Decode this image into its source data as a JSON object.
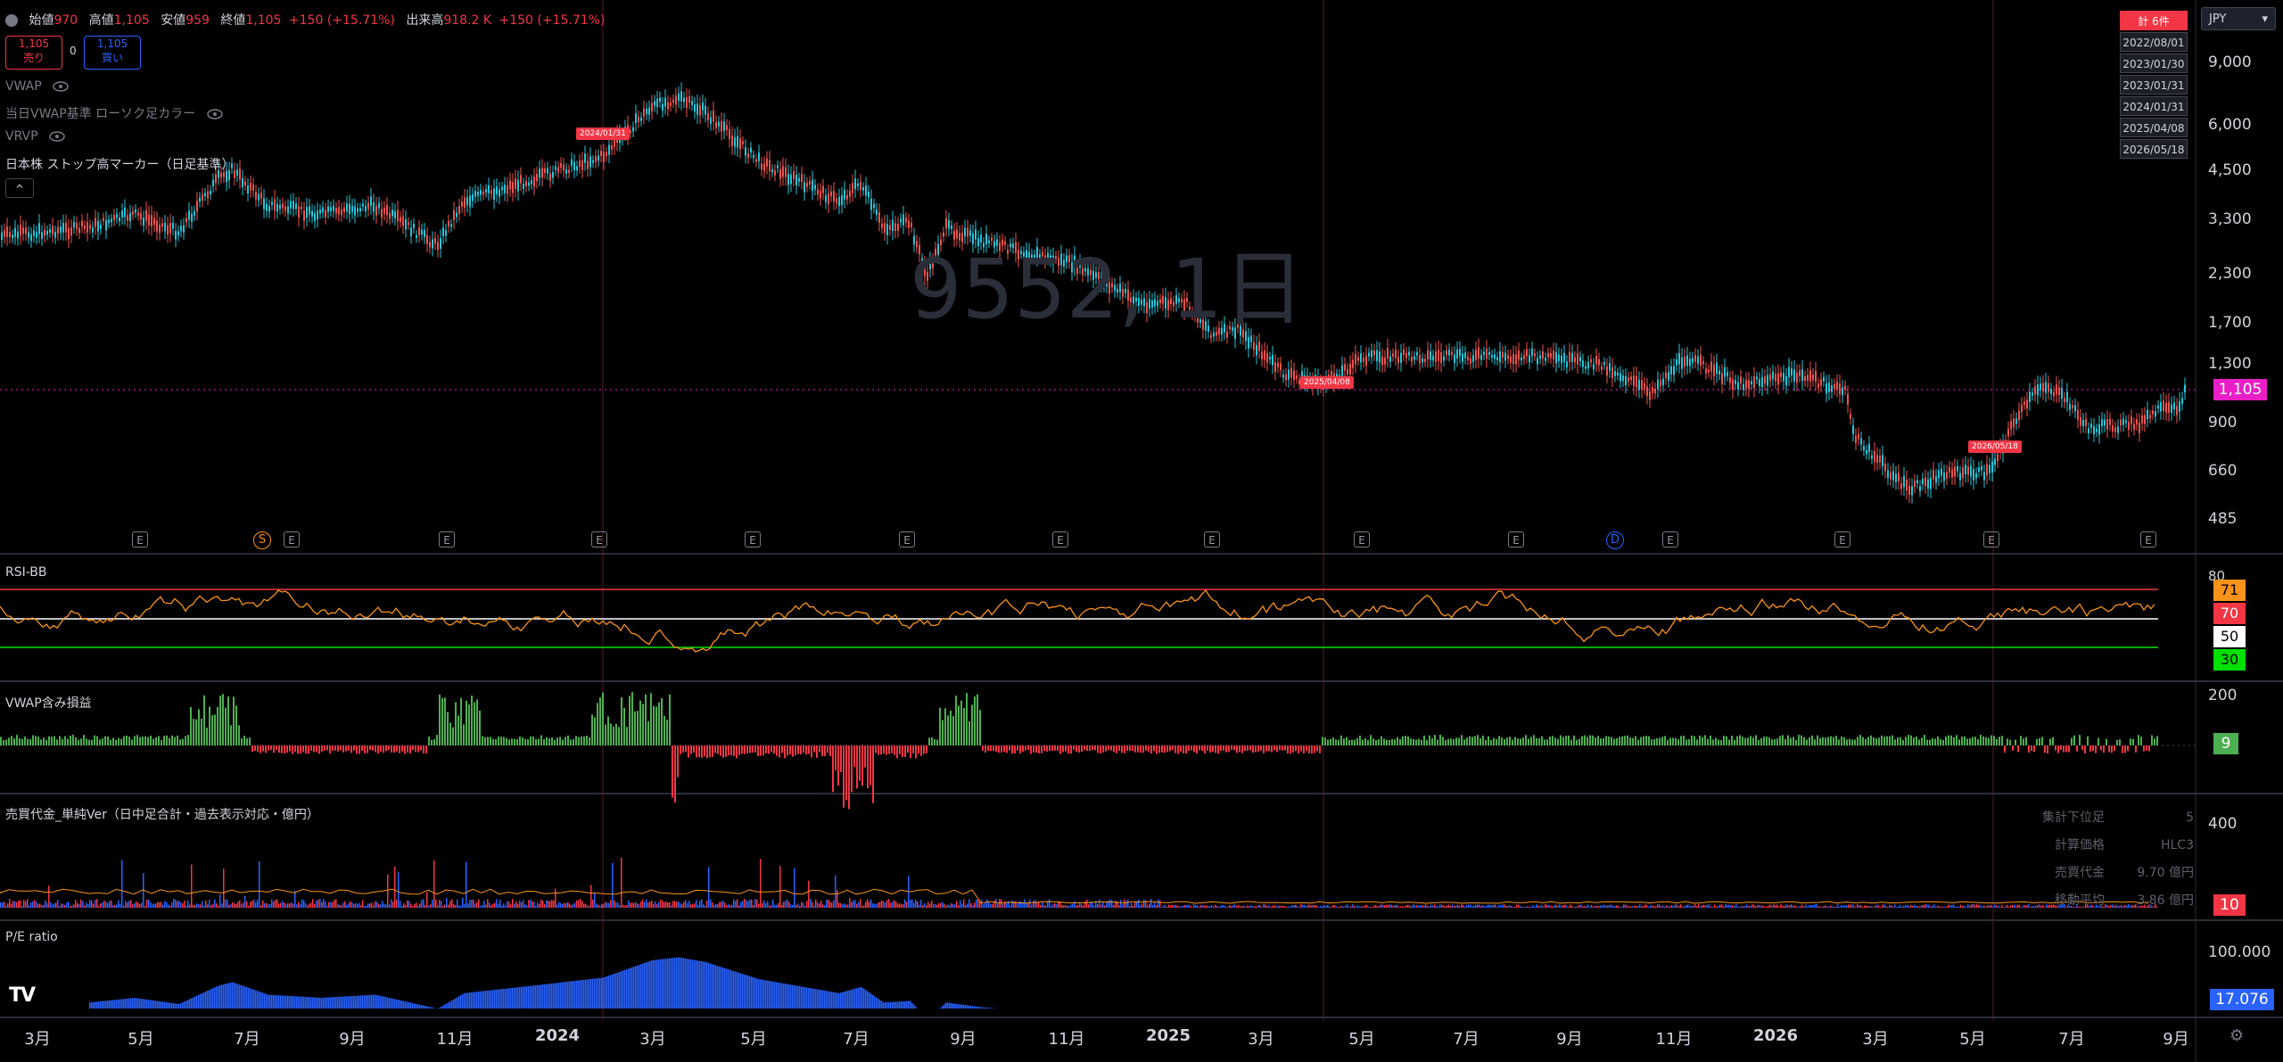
{
  "legend": {
    "open_label": "始値",
    "open": "970",
    "high_label": "高値",
    "high": "1,105",
    "low_label": "安値",
    "low": "959",
    "close_label": "終値",
    "close": "1,105",
    "change": "+150 (+15.71%)",
    "volume_label": "出来高",
    "volume": "918.2 K",
    "volume_change": "+150 (+15.71%)"
  },
  "trade": {
    "sell_price": "1,105",
    "sell_label": "売り",
    "spread": "0",
    "buy_price": "1,105",
    "buy_label": "買い"
  },
  "indicators": {
    "vwap": "VWAP",
    "vwap_candle": "当日VWAP基準 ローソク足カラー",
    "vrvp": "VRVP",
    "stop_marker": "日本株 ストップ高マーカー（日足基準）",
    "collapse": "^"
  },
  "watermark": "9552, 1日",
  "currency": "JPY",
  "date_list": {
    "header": "計 6件",
    "items": [
      "2022/08/01",
      "2023/01/30",
      "2023/01/31",
      "2024/01/31",
      "2025/04/08",
      "2026/05/18"
    ]
  },
  "price_axis": [
    "9,000",
    "6,000",
    "4,500",
    "3,300",
    "2,300",
    "1,700",
    "1,300",
    "900",
    "660",
    "485"
  ],
  "current_price": "1,105",
  "marker_tags": [
    "2024/01/31",
    "2025/04/08",
    "2026/05/18"
  ],
  "event_marks": {
    "earnings": "E",
    "split": "S",
    "dividend": "D"
  },
  "rsi": {
    "title": "RSI-BB",
    "axis_top": "80",
    "tags": [
      "71",
      "70",
      "50",
      "30"
    ]
  },
  "vwap_pl": {
    "title": "VWAP含み損益",
    "axis_top": "200",
    "tag": "9"
  },
  "turnover": {
    "title": "売買代金_単純Ver（日中足合計・過去表示対応・億円）",
    "axis_top": "400",
    "tag": "10",
    "info": [
      {
        "k": "集計下位足",
        "v": "5"
      },
      {
        "k": "計算価格",
        "v": "HLC3"
      },
      {
        "k": "売買代金",
        "v": "9.70 億円"
      },
      {
        "k": "移動平均",
        "v": "3.86 億円"
      }
    ]
  },
  "pe": {
    "title": "P/E ratio",
    "axis_top": "100.000",
    "tag": "17.076"
  },
  "time_axis": [
    "3月",
    "5月",
    "7月",
    "9月",
    "11月",
    "2024",
    "3月",
    "5月",
    "7月",
    "9月",
    "11月",
    "2025",
    "3月",
    "5月",
    "7月",
    "9月",
    "11月",
    "2026",
    "3月",
    "5月",
    "7月",
    "9月"
  ],
  "logo": "TV",
  "colors": {
    "up": "#ef5350",
    "down": "#26c6da",
    "rsi": "#f7931a",
    "vwap_up": "#4caf50",
    "vwap_down": "#f23645",
    "pe_bar": "#2962ff",
    "price_tag": "#e91ec6"
  }
}
